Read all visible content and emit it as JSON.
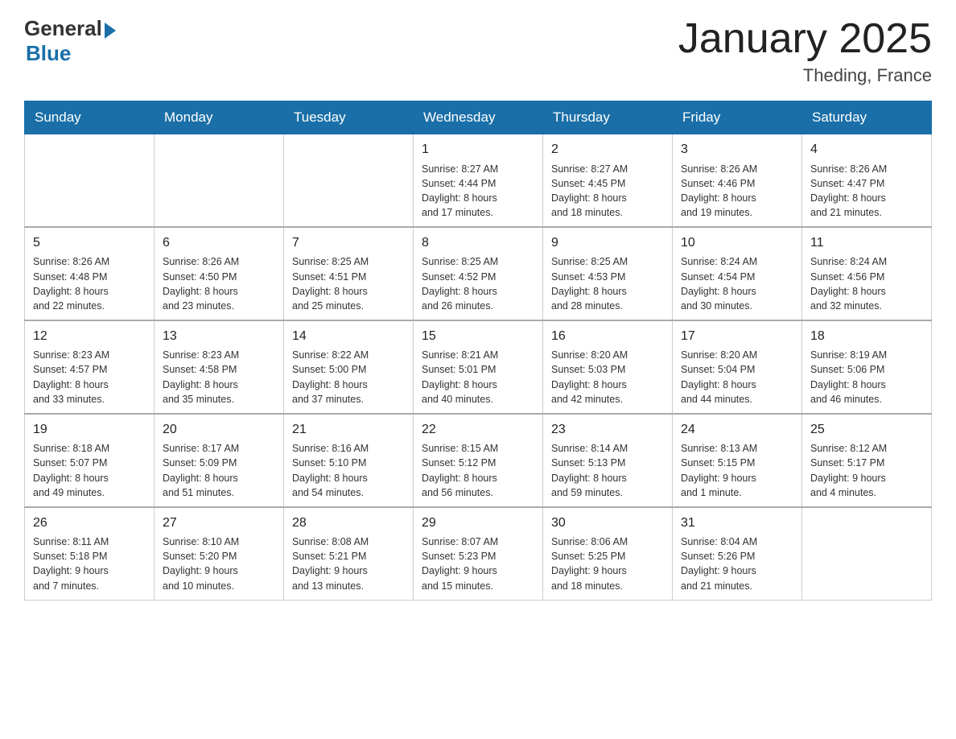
{
  "header": {
    "logo": {
      "general": "General",
      "blue": "Blue"
    },
    "title": "January 2025",
    "subtitle": "Theding, France"
  },
  "calendar": {
    "days_of_week": [
      "Sunday",
      "Monday",
      "Tuesday",
      "Wednesday",
      "Thursday",
      "Friday",
      "Saturday"
    ],
    "weeks": [
      [
        {
          "day": "",
          "info": ""
        },
        {
          "day": "",
          "info": ""
        },
        {
          "day": "",
          "info": ""
        },
        {
          "day": "1",
          "info": "Sunrise: 8:27 AM\nSunset: 4:44 PM\nDaylight: 8 hours\nand 17 minutes."
        },
        {
          "day": "2",
          "info": "Sunrise: 8:27 AM\nSunset: 4:45 PM\nDaylight: 8 hours\nand 18 minutes."
        },
        {
          "day": "3",
          "info": "Sunrise: 8:26 AM\nSunset: 4:46 PM\nDaylight: 8 hours\nand 19 minutes."
        },
        {
          "day": "4",
          "info": "Sunrise: 8:26 AM\nSunset: 4:47 PM\nDaylight: 8 hours\nand 21 minutes."
        }
      ],
      [
        {
          "day": "5",
          "info": "Sunrise: 8:26 AM\nSunset: 4:48 PM\nDaylight: 8 hours\nand 22 minutes."
        },
        {
          "day": "6",
          "info": "Sunrise: 8:26 AM\nSunset: 4:50 PM\nDaylight: 8 hours\nand 23 minutes."
        },
        {
          "day": "7",
          "info": "Sunrise: 8:25 AM\nSunset: 4:51 PM\nDaylight: 8 hours\nand 25 minutes."
        },
        {
          "day": "8",
          "info": "Sunrise: 8:25 AM\nSunset: 4:52 PM\nDaylight: 8 hours\nand 26 minutes."
        },
        {
          "day": "9",
          "info": "Sunrise: 8:25 AM\nSunset: 4:53 PM\nDaylight: 8 hours\nand 28 minutes."
        },
        {
          "day": "10",
          "info": "Sunrise: 8:24 AM\nSunset: 4:54 PM\nDaylight: 8 hours\nand 30 minutes."
        },
        {
          "day": "11",
          "info": "Sunrise: 8:24 AM\nSunset: 4:56 PM\nDaylight: 8 hours\nand 32 minutes."
        }
      ],
      [
        {
          "day": "12",
          "info": "Sunrise: 8:23 AM\nSunset: 4:57 PM\nDaylight: 8 hours\nand 33 minutes."
        },
        {
          "day": "13",
          "info": "Sunrise: 8:23 AM\nSunset: 4:58 PM\nDaylight: 8 hours\nand 35 minutes."
        },
        {
          "day": "14",
          "info": "Sunrise: 8:22 AM\nSunset: 5:00 PM\nDaylight: 8 hours\nand 37 minutes."
        },
        {
          "day": "15",
          "info": "Sunrise: 8:21 AM\nSunset: 5:01 PM\nDaylight: 8 hours\nand 40 minutes."
        },
        {
          "day": "16",
          "info": "Sunrise: 8:20 AM\nSunset: 5:03 PM\nDaylight: 8 hours\nand 42 minutes."
        },
        {
          "day": "17",
          "info": "Sunrise: 8:20 AM\nSunset: 5:04 PM\nDaylight: 8 hours\nand 44 minutes."
        },
        {
          "day": "18",
          "info": "Sunrise: 8:19 AM\nSunset: 5:06 PM\nDaylight: 8 hours\nand 46 minutes."
        }
      ],
      [
        {
          "day": "19",
          "info": "Sunrise: 8:18 AM\nSunset: 5:07 PM\nDaylight: 8 hours\nand 49 minutes."
        },
        {
          "day": "20",
          "info": "Sunrise: 8:17 AM\nSunset: 5:09 PM\nDaylight: 8 hours\nand 51 minutes."
        },
        {
          "day": "21",
          "info": "Sunrise: 8:16 AM\nSunset: 5:10 PM\nDaylight: 8 hours\nand 54 minutes."
        },
        {
          "day": "22",
          "info": "Sunrise: 8:15 AM\nSunset: 5:12 PM\nDaylight: 8 hours\nand 56 minutes."
        },
        {
          "day": "23",
          "info": "Sunrise: 8:14 AM\nSunset: 5:13 PM\nDaylight: 8 hours\nand 59 minutes."
        },
        {
          "day": "24",
          "info": "Sunrise: 8:13 AM\nSunset: 5:15 PM\nDaylight: 9 hours\nand 1 minute."
        },
        {
          "day": "25",
          "info": "Sunrise: 8:12 AM\nSunset: 5:17 PM\nDaylight: 9 hours\nand 4 minutes."
        }
      ],
      [
        {
          "day": "26",
          "info": "Sunrise: 8:11 AM\nSunset: 5:18 PM\nDaylight: 9 hours\nand 7 minutes."
        },
        {
          "day": "27",
          "info": "Sunrise: 8:10 AM\nSunset: 5:20 PM\nDaylight: 9 hours\nand 10 minutes."
        },
        {
          "day": "28",
          "info": "Sunrise: 8:08 AM\nSunset: 5:21 PM\nDaylight: 9 hours\nand 13 minutes."
        },
        {
          "day": "29",
          "info": "Sunrise: 8:07 AM\nSunset: 5:23 PM\nDaylight: 9 hours\nand 15 minutes."
        },
        {
          "day": "30",
          "info": "Sunrise: 8:06 AM\nSunset: 5:25 PM\nDaylight: 9 hours\nand 18 minutes."
        },
        {
          "day": "31",
          "info": "Sunrise: 8:04 AM\nSunset: 5:26 PM\nDaylight: 9 hours\nand 21 minutes."
        },
        {
          "day": "",
          "info": ""
        }
      ]
    ]
  }
}
